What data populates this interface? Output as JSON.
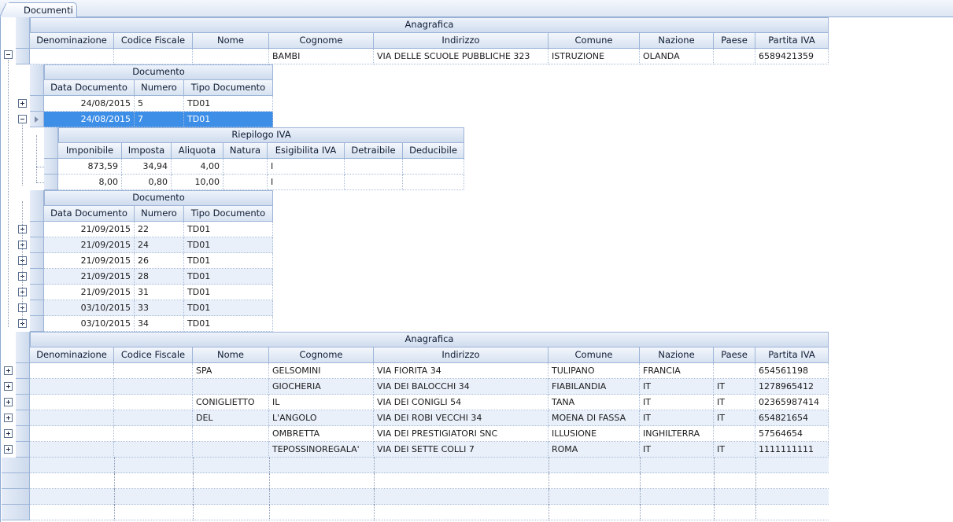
{
  "tab": {
    "label": "Documenti"
  },
  "anagrafica_band": "Anagrafica",
  "documento_band": "Documento",
  "riepilogo_band": "Riepilogo IVA",
  "anag_cols": [
    "Denominazione",
    "Codice Fiscale",
    "Nome",
    "Cognome",
    "Indirizzo",
    "Comune",
    "Nazione",
    "Paese",
    "Partita IVA"
  ],
  "doc_cols": [
    "Data Documento",
    "Numero",
    "Tipo Documento"
  ],
  "iva_cols": [
    "Imponibile",
    "Imposta",
    "Aliquota",
    "Natura",
    "Esigibilita IVA",
    "Detraibile",
    "Deducibile"
  ],
  "first_record": [
    "",
    "",
    "",
    "BAMBI",
    "VIA DELLE SCUOLE PUBBLICHE 323",
    "ISTRUZIONE",
    "OLANDA",
    "",
    "6589421359"
  ],
  "docs1": [
    [
      "24/08/2015",
      "5",
      "TD01"
    ],
    [
      "24/08/2015",
      "7",
      "TD01"
    ]
  ],
  "iva_rows": [
    [
      "873,59",
      "34,94",
      "4,00",
      "",
      "I",
      "",
      ""
    ],
    [
      "8,00",
      "0,80",
      "10,00",
      "",
      "I",
      "",
      ""
    ]
  ],
  "docs2": [
    [
      "21/09/2015",
      "22",
      "TD01"
    ],
    [
      "21/09/2015",
      "24",
      "TD01"
    ],
    [
      "21/09/2015",
      "26",
      "TD01"
    ],
    [
      "21/09/2015",
      "28",
      "TD01"
    ],
    [
      "21/09/2015",
      "31",
      "TD01"
    ],
    [
      "03/10/2015",
      "33",
      "TD01"
    ],
    [
      "03/10/2015",
      "34",
      "TD01"
    ]
  ],
  "anag_rows": [
    [
      "",
      "",
      "SPA",
      "GELSOMINI",
      "VIA FIORITA 34",
      "TULIPANO",
      "FRANCIA",
      "",
      "654561198"
    ],
    [
      "",
      "",
      "",
      "GIOCHERIA",
      "VIA DEI BALOCCHI 34",
      "FIABILANDIA",
      "IT",
      "IT",
      "1278965412"
    ],
    [
      "",
      "",
      "CONIGLIETTO",
      "IL",
      "VIA DEI CONIGLI 54",
      "TANA",
      "IT",
      "IT",
      "02365987414"
    ],
    [
      "",
      "",
      "DEL",
      "L'ANGOLO",
      "VIA DEI ROBI VECCHI 34",
      "MOENA DI FASSA",
      "IT",
      "IT",
      "654821654"
    ],
    [
      "",
      "",
      "",
      "OMBRETTA",
      "VIA DEI PRESTIGIATORI SNC",
      "ILLUSIONE",
      "INGHILTERRA",
      "",
      "57564654"
    ],
    [
      "",
      "",
      "",
      "TEPOSSINOREGALA'",
      "VIA DEI SETTE COLLI 7",
      "ROMA",
      "IT",
      "IT",
      "1111111111"
    ]
  ],
  "colors": {
    "selection": "#3d8ee7",
    "header": "#d7e2f1",
    "alt_row": "#e9f0fa"
  }
}
